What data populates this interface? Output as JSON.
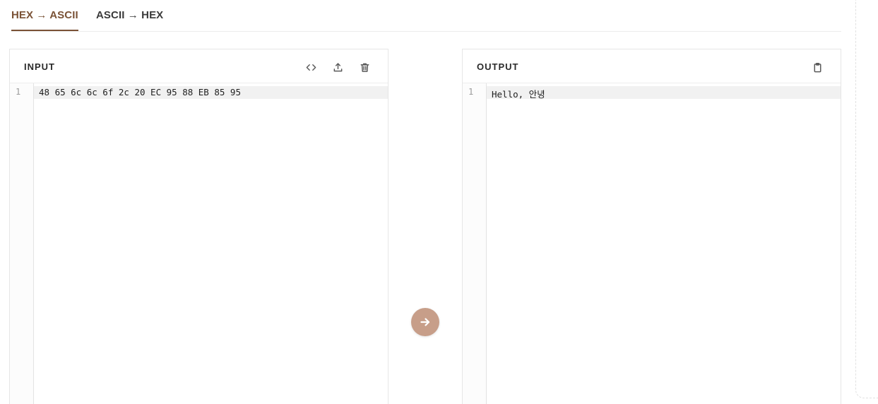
{
  "tabs": [
    {
      "label": "HEX → ASCII",
      "active": true
    },
    {
      "label": "ASCII → HEX",
      "active": false
    }
  ],
  "input_panel": {
    "title": "INPUT",
    "icons": [
      "code-icon",
      "upload-icon",
      "trash-icon"
    ],
    "lines": [
      {
        "number": "1",
        "text": "48 65 6c 6c 6f 2c 20 EC 95 88 EB 85 95"
      }
    ]
  },
  "output_panel": {
    "title": "OUTPUT",
    "icons": [
      "clipboard-icon"
    ],
    "lines": [
      {
        "number": "1",
        "text": "Hello, 안녕"
      }
    ]
  },
  "convert_button": {
    "icon": "arrow-right-icon"
  },
  "colors": {
    "accent": "#7a5236",
    "convert_button_bg": "#c79e89",
    "border": "#e6e6e6"
  }
}
